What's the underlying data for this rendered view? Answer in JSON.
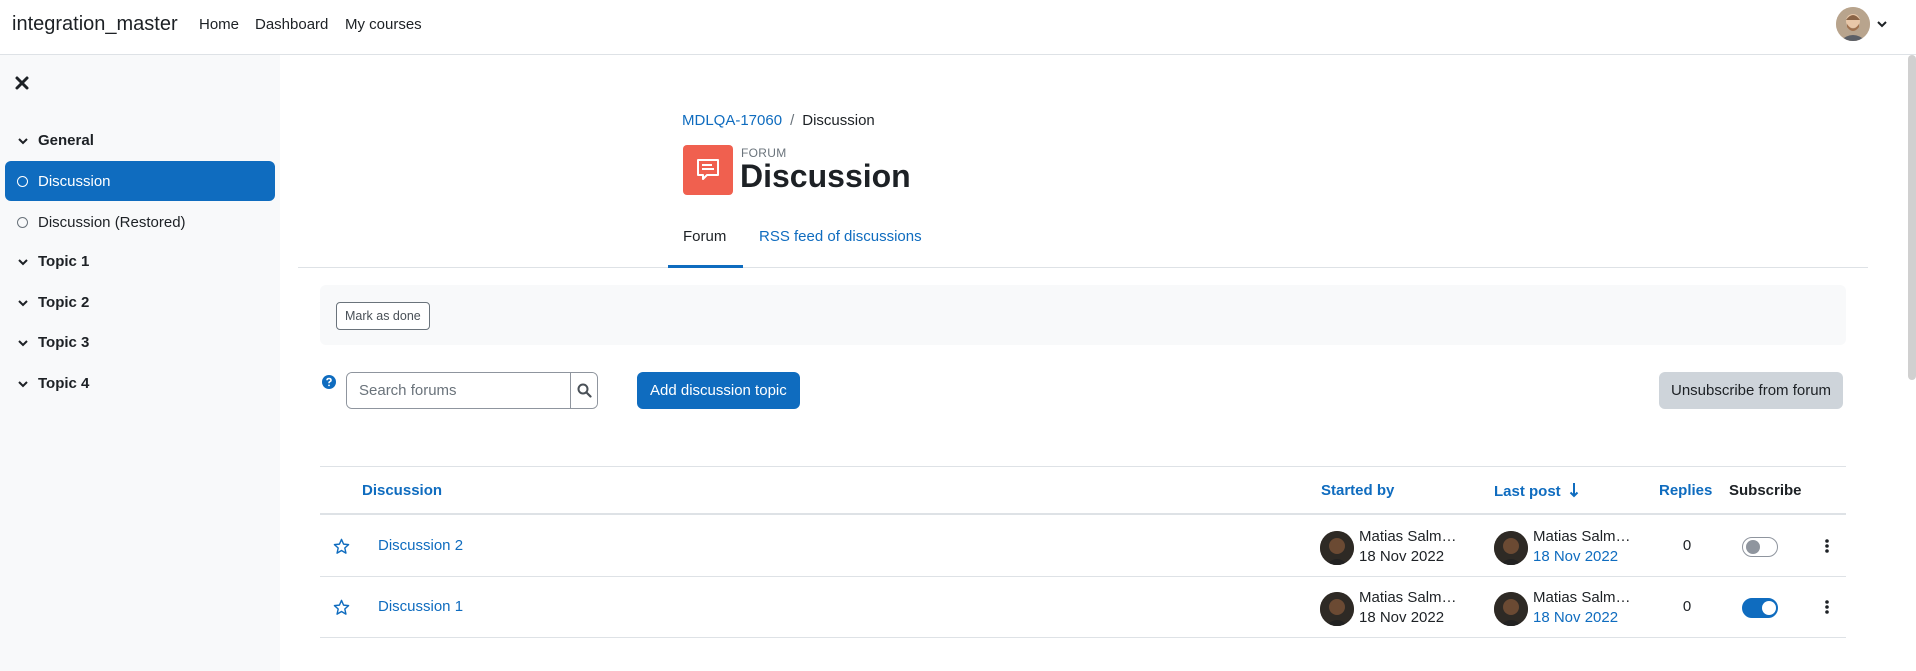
{
  "navbar": {
    "brand": "integration_master",
    "links": [
      "Home",
      "Dashboard",
      "My courses"
    ]
  },
  "drawer": {
    "sections": [
      {
        "label": "General"
      },
      {
        "label": "Topic 1"
      },
      {
        "label": "Topic 2"
      },
      {
        "label": "Topic 3"
      },
      {
        "label": "Topic 4"
      }
    ],
    "activities": [
      {
        "label": "Discussion",
        "active": true
      },
      {
        "label": "Discussion (Restored)",
        "active": false
      }
    ]
  },
  "breadcrumb": {
    "course": "MDLQA-17060",
    "separator": "/",
    "current": "Discussion"
  },
  "header": {
    "subtitle": "FORUM",
    "title": "Discussion"
  },
  "tabs": [
    {
      "label": "Forum",
      "active": true
    },
    {
      "label": "RSS feed of discussions",
      "active": false
    }
  ],
  "completion": {
    "mark_done_label": "Mark as done"
  },
  "toolbar": {
    "search_placeholder": "Search forums",
    "add_label": "Add discussion topic",
    "unsubscribe_label": "Unsubscribe from forum"
  },
  "table": {
    "headers": {
      "discussion": "Discussion",
      "started_by": "Started by",
      "last_post": "Last post",
      "replies": "Replies",
      "subscribe": "Subscribe"
    },
    "rows": [
      {
        "name": "Discussion 2",
        "starter": "Matias Salmerón",
        "start_date": "18 Nov 2022",
        "last_user": "Matias Salmerón",
        "last_date": "18 Nov 2022",
        "replies": "0",
        "subscribed": false
      },
      {
        "name": "Discussion 1",
        "starter": "Matias Salmerón",
        "start_date": "18 Nov 2022",
        "last_user": "Matias Salmerón",
        "last_date": "18 Nov 2022",
        "replies": "0",
        "subscribed": true
      }
    ]
  },
  "colors": {
    "primary": "#0f6cbf",
    "forum_icon": "#f0604f",
    "drawer_bg": "#f8f9fa"
  }
}
